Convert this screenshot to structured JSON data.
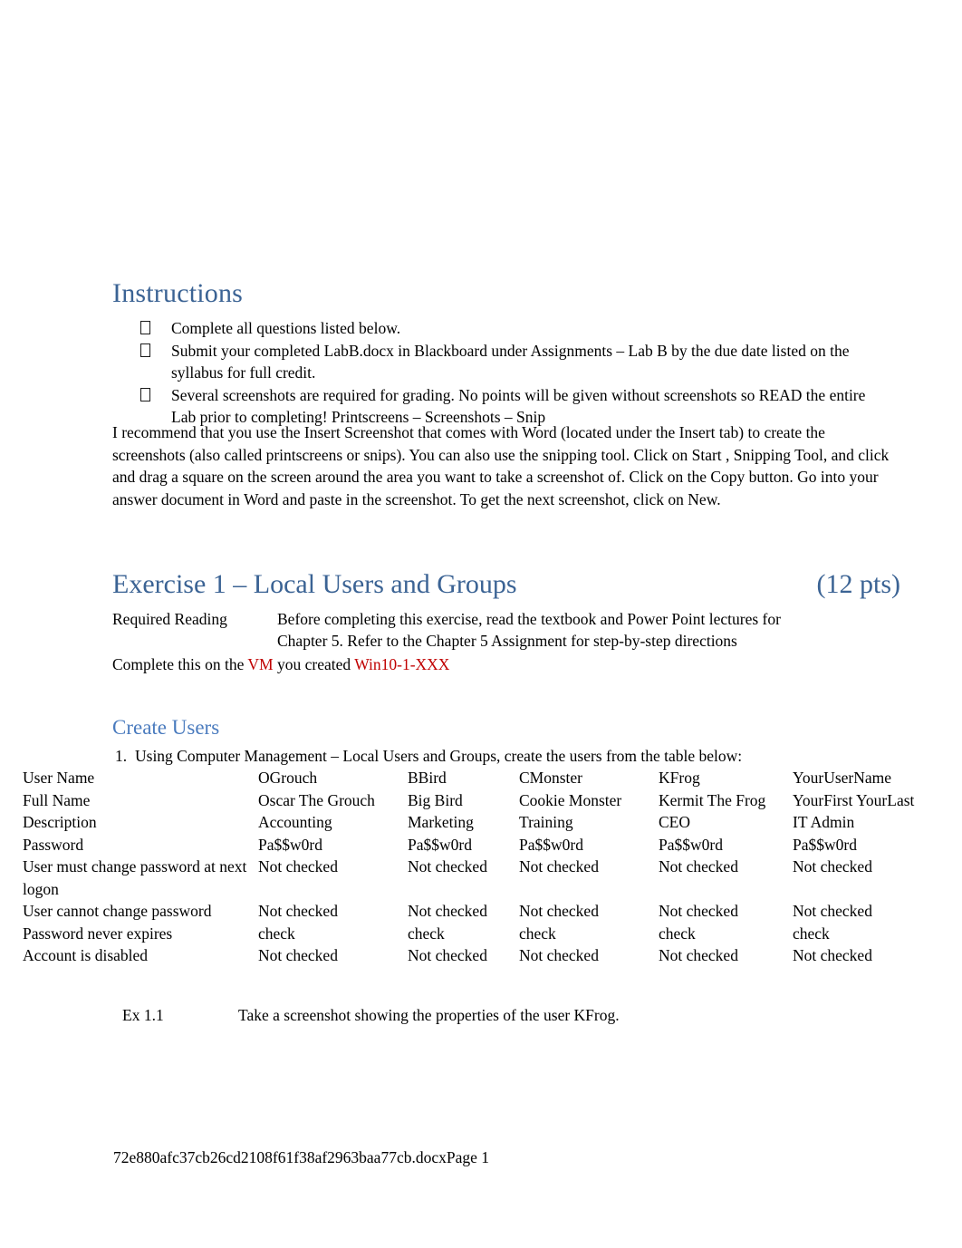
{
  "document": {
    "sections": {
      "instructions": {
        "heading": "Instructions",
        "bullets": [
          "Complete all questions listed below.",
          "Submit your completed  LabB.docx in Blackboard under Assignments – Lab B by the due date listed on the syllabus for full credit.",
          "Several screenshots are required for grading.   No points will be given without screenshots so READ the entire Lab prior to completing!   Printscreens – Screenshots – Snip"
        ],
        "bullet_marker_glyph": "missing-glyph-box",
        "paragraph": "I recommend that you use the  Insert Screenshot  that comes with Word (located under the Insert tab) to create the screenshots (also called printscreens or snips).    You can also use the snipping tool.  Click on Start , Snipping Tool, and click and drag a square on the screen around the area you want to take a screenshot of.  Click on the Copy button.   Go into your answer document in Word and paste in the screenshot.    To get the next screenshot, click on  New."
      },
      "exercise1": {
        "heading": "Exercise 1 – Local Users and Groups",
        "points": "(12 pts)",
        "required_reading_label": "Required Reading",
        "required_reading_line1": "Before completing this exercise, read the textbook and Power Point lectures for",
        "required_reading_line2": "Chapter 5. Refer to the Chapter 5 Assignment for step-by-step directions",
        "complete_prefix": "Complete this on the ",
        "complete_vm": "VM",
        "complete_middle": " you created ",
        "complete_vmname": "Win10-1-XXX"
      },
      "create_users": {
        "heading": "Create Users",
        "step_number": "1.",
        "step_text": "Using Computer Management – Local Users and Groups,   create the users from the table below:",
        "table": {
          "rows": [
            {
              "label": "User Name",
              "values": [
                "OGrouch",
                "BBird",
                "CMonster",
                "KFrog",
                "YourUserName"
              ]
            },
            {
              "label": "Full Name",
              "values": [
                "Oscar The Grouch",
                "Big Bird",
                "Cookie Monster",
                "Kermit The Frog",
                "YourFirst YourLast"
              ]
            },
            {
              "label": "Description",
              "values": [
                "Accounting",
                "Marketing",
                "Training",
                "CEO",
                "IT Admin"
              ]
            },
            {
              "label": "Password",
              "values": [
                "Pa$$w0rd",
                "Pa$$w0rd",
                "Pa$$w0rd",
                "Pa$$w0rd",
                "Pa$$w0rd"
              ]
            },
            {
              "label": "User must change password at next logon",
              "values": [
                "Not checked",
                "Not checked",
                "Not checked",
                "Not checked",
                "Not checked"
              ]
            },
            {
              "label": "User cannot change password",
              "values": [
                "Not checked",
                "Not checked",
                "Not checked",
                "Not checked",
                "Not checked"
              ]
            },
            {
              "label": "Password never expires",
              "values": [
                "check",
                "check",
                "check",
                "check",
                "check"
              ]
            },
            {
              "label": "Account is disabled",
              "values": [
                "Not checked",
                "Not checked",
                "Not checked",
                "Not checked",
                "Not checked"
              ]
            }
          ]
        },
        "ex_item_label": "Ex 1.1",
        "ex_item_text": "Take a screenshot showing the properties of the user KFrog."
      }
    },
    "footer": {
      "text": "72e880afc37cb26cd2108f61f38af2963baa77cb.docxPage 1"
    },
    "colors": {
      "heading_blue": "#3B6394",
      "subheading_blue": "#4A7BBE",
      "accent_red": "#C00000",
      "body_text": "#000000",
      "page_background": "#FFFFFF"
    }
  }
}
